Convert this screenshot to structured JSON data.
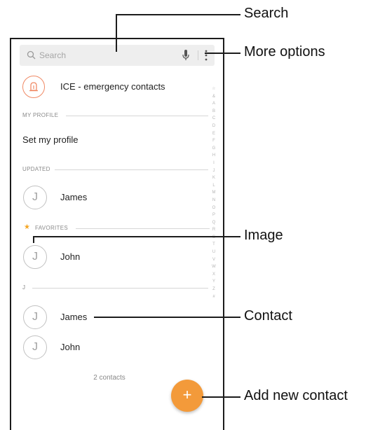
{
  "search": {
    "placeholder": "Search"
  },
  "ice": {
    "label": "ICE - emergency contacts"
  },
  "sections": {
    "my_profile": "MY PROFILE",
    "updated": "UPDATED",
    "favorites": "FAVORITES",
    "j": "J"
  },
  "profile": {
    "set_label": "Set my profile"
  },
  "contacts": {
    "updated": [
      {
        "initial": "J",
        "name": "James"
      }
    ],
    "favorites": [
      {
        "initial": "J",
        "name": "John"
      }
    ],
    "j_group": [
      {
        "initial": "J",
        "name": "James"
      },
      {
        "initial": "J",
        "name": "John"
      }
    ]
  },
  "count_label": "2 contacts",
  "fab_label": "+",
  "index_letters": [
    "☆",
    "&",
    "A",
    "B",
    "C",
    "D",
    "E",
    "F",
    "G",
    "H",
    "I",
    "J",
    "K",
    "L",
    "M",
    "N",
    "O",
    "P",
    "Q",
    "R",
    "S",
    "T",
    "U",
    "V",
    "W",
    "X",
    "Y",
    "Z",
    "#"
  ],
  "callouts": {
    "search": "Search",
    "more_options": "More options",
    "image": "Image",
    "contact": "Contact",
    "add_new_contact": "Add new contact"
  },
  "colors": {
    "accent": "#f39a3a",
    "ice": "#f08a66",
    "star": "#f5a623"
  }
}
